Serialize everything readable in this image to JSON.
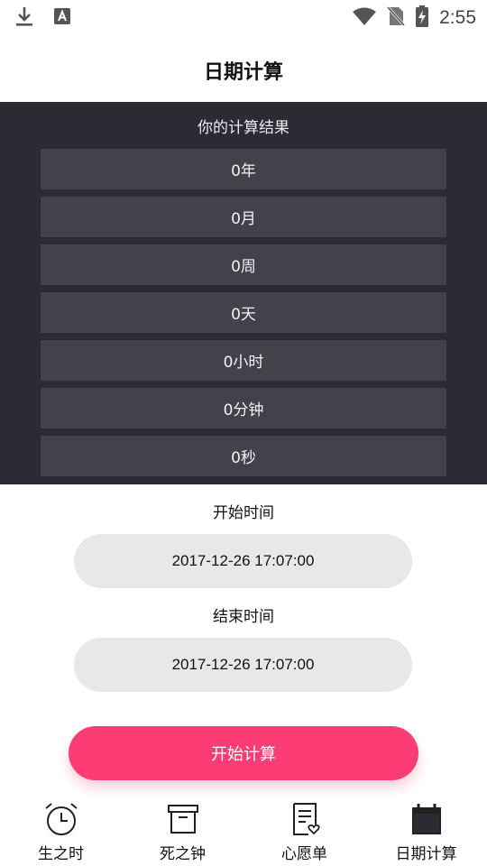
{
  "status_bar": {
    "time": "2:55",
    "icons": [
      "download-icon",
      "a-icon",
      "wifi-icon",
      "no-sim-icon",
      "battery-charging-icon"
    ]
  },
  "header": {
    "title": "日期计算"
  },
  "results": {
    "title": "你的计算结果",
    "rows": [
      "0年",
      "0月",
      "0周",
      "0天",
      "0小时",
      "0分钟",
      "0秒"
    ]
  },
  "start_time": {
    "label": "开始时间",
    "value": "2017-12-26 17:07:00"
  },
  "end_time": {
    "label": "结束时间",
    "value": "2017-12-26 17:07:00"
  },
  "action": {
    "start_label": "开始计算"
  },
  "bottom_nav": {
    "items": [
      {
        "label": "生之时",
        "icon": "alarm-clock-icon"
      },
      {
        "label": "死之钟",
        "icon": "archive-box-icon"
      },
      {
        "label": "心愿单",
        "icon": "wish-list-icon"
      },
      {
        "label": "日期计算",
        "icon": "calendar-icon"
      }
    ]
  },
  "colors": {
    "panel_bg": "#2b2b33",
    "row_bg": "#42424b",
    "field_bg": "#e8e8e8",
    "accent": "#fb3c75"
  }
}
